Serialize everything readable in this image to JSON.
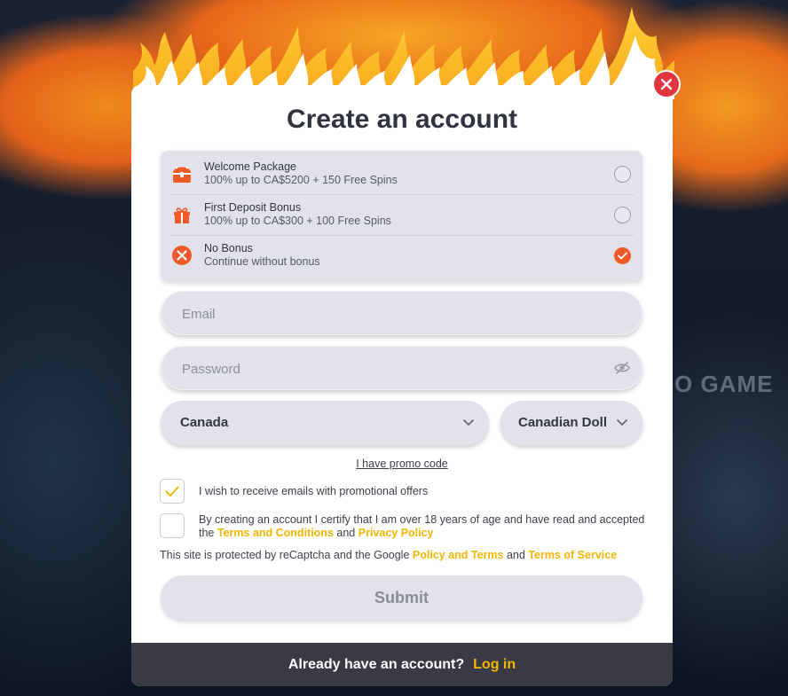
{
  "background": {
    "partial_text": "O GAME"
  },
  "modal": {
    "title": "Create an account",
    "close_icon": "close-icon",
    "bonuses": [
      {
        "icon": "treasure-chest-icon",
        "title": "Welcome Package",
        "subtitle": "100% up to CA$5200 + 150 Free Spins",
        "selected": false
      },
      {
        "icon": "gift-icon",
        "title": "First Deposit Bonus",
        "subtitle": "100% up to CA$300 + 100 Free Spins",
        "selected": false
      },
      {
        "icon": "no-bonus-x-icon",
        "title": "No Bonus",
        "subtitle": "Continue without bonus",
        "selected": true
      }
    ],
    "email": {
      "placeholder": "Email",
      "value": ""
    },
    "password": {
      "placeholder": "Password",
      "value": ""
    },
    "country": {
      "value": "Canada"
    },
    "currency": {
      "value": "Canadian Dollar"
    },
    "promo_link": "I have promo code",
    "consent_emails": {
      "label": "I wish to receive emails with promotional offers",
      "checked": true
    },
    "consent_terms": {
      "label_prefix": "By creating an account I certify that I am over 18 years of age and have read and accepted the",
      "terms_link": "Terms and Conditions",
      "and": "and",
      "privacy_link": "Privacy Policy",
      "checked": false
    },
    "recaptcha": {
      "prefix": "This site is protected by reCaptcha and the Google",
      "policy_link": "Policy and Terms",
      "and": "and",
      "tos_link": "Terms of Service"
    },
    "submit_label": "Submit",
    "footer": {
      "question": "Already have an account?",
      "login_link": "Log in"
    }
  },
  "colors": {
    "accent_orange": "#f05a28",
    "link_yellow": "#f2b705",
    "close_red": "#e0343f",
    "footer_bg": "#3a3a44"
  }
}
